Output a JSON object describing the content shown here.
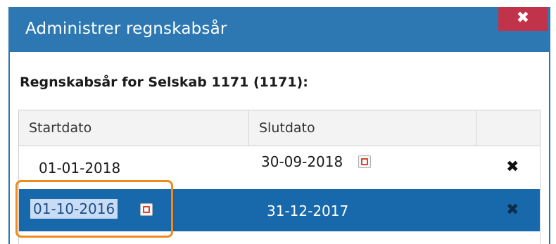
{
  "dialog": {
    "title": "Administrer regnskabsår",
    "close_label": "✖"
  },
  "section": {
    "heading": "Regnskabsår for Selskab 1171 (1171):"
  },
  "grid": {
    "columns": [
      "Startdato",
      "Slutdato",
      ""
    ],
    "rows": [
      {
        "start": "01-01-2018",
        "end": "30-09-2018",
        "selected": false,
        "editing": false
      },
      {
        "start": "01-10-2016",
        "end": "31-12-2017",
        "selected": true,
        "editing": true
      }
    ],
    "delete_label": "✖"
  },
  "colors": {
    "titlebar": "#2d78b3",
    "close_button": "#c1334a",
    "selected_row": "#1868ac",
    "highlight": "#f08a1c"
  }
}
